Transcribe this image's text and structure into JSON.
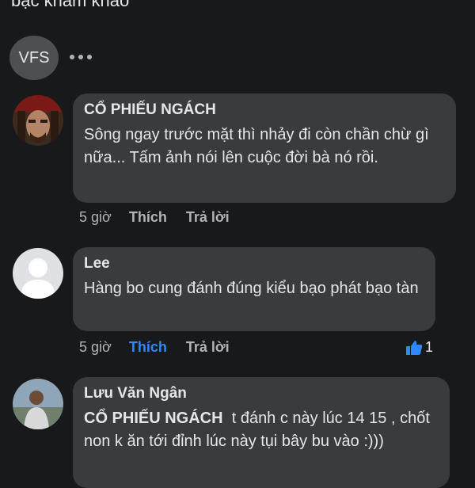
{
  "top_text": "bạc khảm khảo",
  "post": {
    "author_initials": "VFS",
    "more_icon": "more-horizontal-icon"
  },
  "comments": [
    {
      "author": "CỔ PHIẾU NGÁCH",
      "text": "Sông ngay trước mặt thì nhảy đi còn chần chừ gì nữa... Tấm ảnh nói lên cuộc đời bà nó rồi.",
      "time": "5 giờ",
      "like_label": "Thích",
      "reply_label": "Trả lời"
    },
    {
      "author": "Lee",
      "text": "Hàng bo cung đánh đúng kiểu bạo phát bạo tàn",
      "time": "5 giờ",
      "like_label": "Thích",
      "reply_label": "Trả lời",
      "reaction_count": "1",
      "liked": true
    },
    {
      "author": "Lưu Văn Ngân",
      "tag": "CỔ PHIẾU NGÁCH",
      "text": "t đánh c này lúc 14 15 , chốt non k ăn tới đỉnh lúc này tụi bây bu vào :)))"
    }
  ],
  "colors": {
    "background": "#18191a",
    "bubble": "#3a3b3c",
    "text": "#e4e6eb",
    "muted": "#b0b3b8",
    "accent": "#2d88ff"
  }
}
